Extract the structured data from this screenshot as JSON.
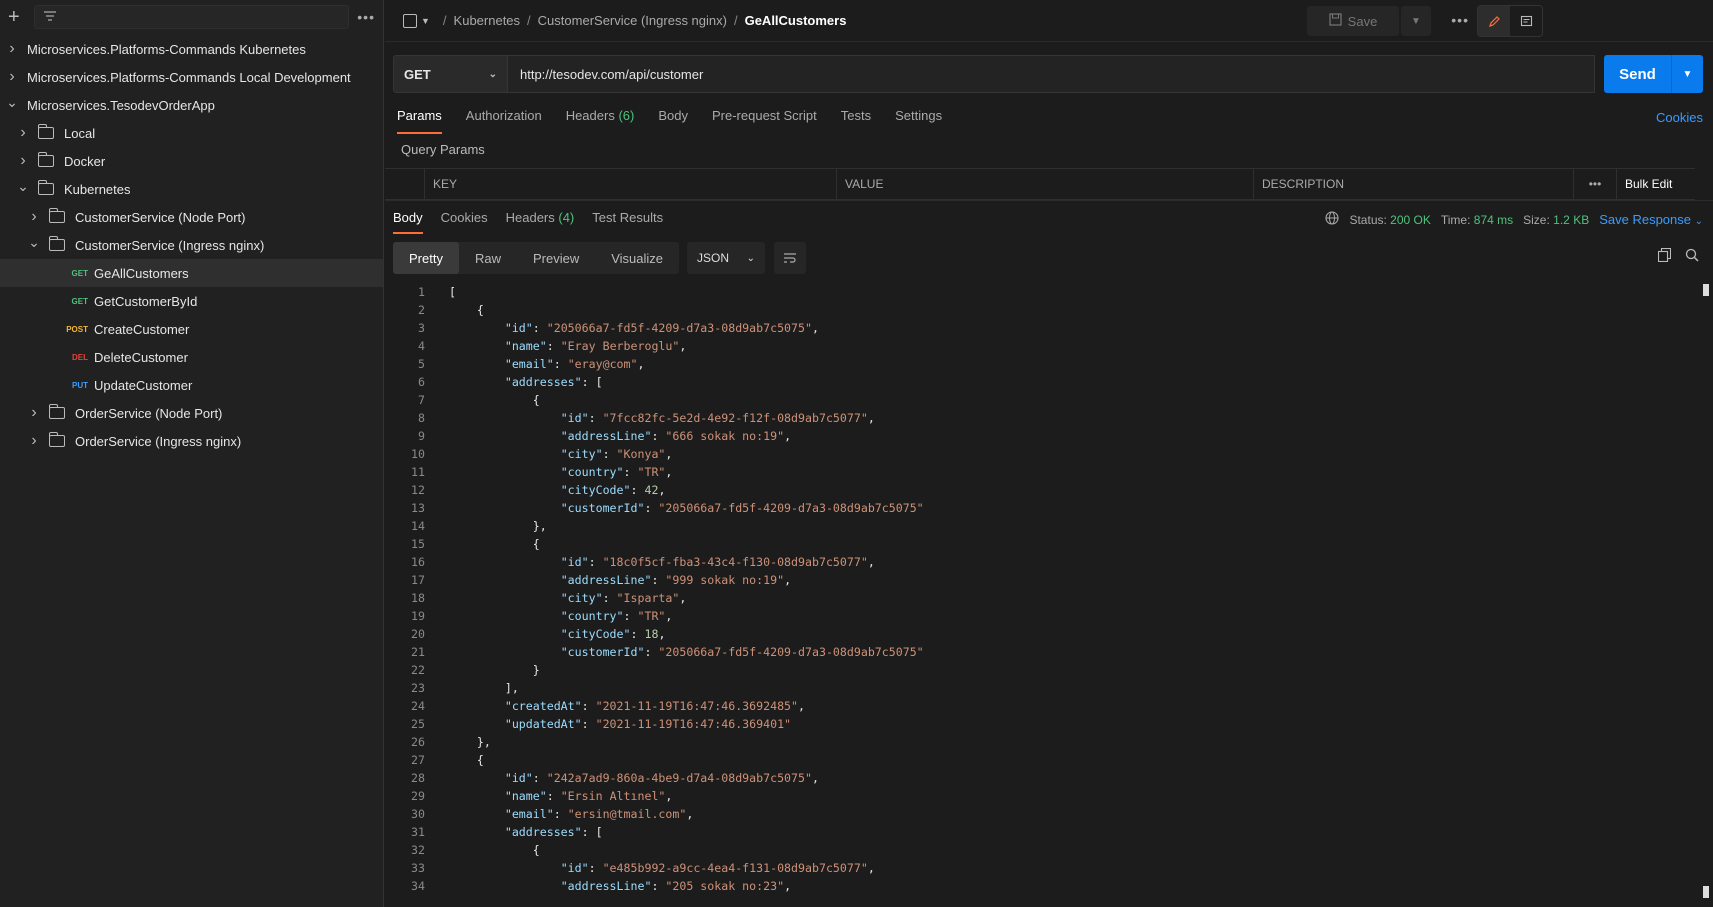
{
  "sidebar": {
    "filter_placeholder": "",
    "items": [
      {
        "label": "Microservices.Platforms-Commands Kubernetes",
        "type": "collection",
        "depth": 0,
        "chev": "right"
      },
      {
        "label": "Microservices.Platforms-Commands Local Development",
        "type": "collection",
        "depth": 0,
        "chev": "right"
      },
      {
        "label": "Microservices.TesodevOrderApp",
        "type": "collection",
        "depth": 0,
        "chev": "down"
      },
      {
        "label": "Local",
        "type": "folder",
        "depth": 1,
        "chev": "right"
      },
      {
        "label": "Docker",
        "type": "folder",
        "depth": 1,
        "chev": "right"
      },
      {
        "label": "Kubernetes",
        "type": "folder",
        "depth": 1,
        "chev": "down"
      },
      {
        "label": "CustomerService (Node Port)",
        "type": "folder",
        "depth": 2,
        "chev": "right"
      },
      {
        "label": "CustomerService (Ingress nginx)",
        "type": "folder",
        "depth": 2,
        "chev": "down"
      },
      {
        "label": "GeAllCustomers",
        "type": "request",
        "method": "GET",
        "depth": 3,
        "selected": true
      },
      {
        "label": "GetCustomerById",
        "type": "request",
        "method": "GET",
        "depth": 3
      },
      {
        "label": "CreateCustomer",
        "type": "request",
        "method": "POST",
        "depth": 3
      },
      {
        "label": "DeleteCustomer",
        "type": "request",
        "method": "DEL",
        "depth": 3
      },
      {
        "label": "UpdateCustomer",
        "type": "request",
        "method": "PUT",
        "depth": 3
      },
      {
        "label": "OrderService (Node Port)",
        "type": "folder",
        "depth": 2,
        "chev": "right"
      },
      {
        "label": "OrderService (Ingress nginx)",
        "type": "folder",
        "depth": 2,
        "chev": "right"
      }
    ]
  },
  "method_colors": {
    "GET": "#4ec27d",
    "POST": "#f5b431",
    "DEL": "#e0453b",
    "PUT": "#3b9cff"
  },
  "breadcrumb": {
    "c1": "Kubernetes",
    "c2": "CustomerService (Ingress nginx)",
    "current": "GeAllCustomers"
  },
  "toolbar": {
    "save": "Save"
  },
  "request": {
    "method": "GET",
    "url": "http://tesodev.com/api/customer",
    "send": "Send"
  },
  "req_tabs": {
    "params": "Params",
    "authorization": "Authorization",
    "headers": "Headers",
    "headers_count": "(6)",
    "body": "Body",
    "prerequest": "Pre-request Script",
    "tests": "Tests",
    "settings": "Settings",
    "cookies": "Cookies"
  },
  "query_params": {
    "title": "Query Params",
    "key": "KEY",
    "value": "VALUE",
    "description": "DESCRIPTION",
    "bulk_edit": "Bulk Edit"
  },
  "res_tabs": {
    "body": "Body",
    "cookies": "Cookies",
    "headers": "Headers",
    "headers_count": "(4)",
    "test_results": "Test Results"
  },
  "response_status": {
    "status_label": "Status:",
    "status": "200 OK",
    "time_label": "Time:",
    "time": "874 ms",
    "size_label": "Size:",
    "size": "1.2 KB",
    "save_response": "Save Response"
  },
  "view": {
    "pretty": "Pretty",
    "raw": "Raw",
    "preview": "Preview",
    "visualize": "Visualize",
    "format": "JSON"
  },
  "code_lines": [
    [
      {
        "t": "p",
        "v": "["
      }
    ],
    [
      {
        "t": "p",
        "v": "    {"
      }
    ],
    [
      {
        "t": "p",
        "v": "        "
      },
      {
        "t": "k",
        "v": "\"id\""
      },
      {
        "t": "p",
        "v": ": "
      },
      {
        "t": "s",
        "v": "\"205066a7-fd5f-4209-d7a3-08d9ab7c5075\""
      },
      {
        "t": "p",
        "v": ","
      }
    ],
    [
      {
        "t": "p",
        "v": "        "
      },
      {
        "t": "k",
        "v": "\"name\""
      },
      {
        "t": "p",
        "v": ": "
      },
      {
        "t": "s",
        "v": "\"Eray Berberoglu\""
      },
      {
        "t": "p",
        "v": ","
      }
    ],
    [
      {
        "t": "p",
        "v": "        "
      },
      {
        "t": "k",
        "v": "\"email\""
      },
      {
        "t": "p",
        "v": ": "
      },
      {
        "t": "s",
        "v": "\"eray@com\""
      },
      {
        "t": "p",
        "v": ","
      }
    ],
    [
      {
        "t": "p",
        "v": "        "
      },
      {
        "t": "k",
        "v": "\"addresses\""
      },
      {
        "t": "p",
        "v": ": ["
      }
    ],
    [
      {
        "t": "p",
        "v": "            {"
      }
    ],
    [
      {
        "t": "p",
        "v": "                "
      },
      {
        "t": "k",
        "v": "\"id\""
      },
      {
        "t": "p",
        "v": ": "
      },
      {
        "t": "s",
        "v": "\"7fcc82fc-5e2d-4e92-f12f-08d9ab7c5077\""
      },
      {
        "t": "p",
        "v": ","
      }
    ],
    [
      {
        "t": "p",
        "v": "                "
      },
      {
        "t": "k",
        "v": "\"addressLine\""
      },
      {
        "t": "p",
        "v": ": "
      },
      {
        "t": "s",
        "v": "\"666 sokak no:19\""
      },
      {
        "t": "p",
        "v": ","
      }
    ],
    [
      {
        "t": "p",
        "v": "                "
      },
      {
        "t": "k",
        "v": "\"city\""
      },
      {
        "t": "p",
        "v": ": "
      },
      {
        "t": "s",
        "v": "\"Konya\""
      },
      {
        "t": "p",
        "v": ","
      }
    ],
    [
      {
        "t": "p",
        "v": "                "
      },
      {
        "t": "k",
        "v": "\"country\""
      },
      {
        "t": "p",
        "v": ": "
      },
      {
        "t": "s",
        "v": "\"TR\""
      },
      {
        "t": "p",
        "v": ","
      }
    ],
    [
      {
        "t": "p",
        "v": "                "
      },
      {
        "t": "k",
        "v": "\"cityCode\""
      },
      {
        "t": "p",
        "v": ": "
      },
      {
        "t": "n",
        "v": "42"
      },
      {
        "t": "p",
        "v": ","
      }
    ],
    [
      {
        "t": "p",
        "v": "                "
      },
      {
        "t": "k",
        "v": "\"customerId\""
      },
      {
        "t": "p",
        "v": ": "
      },
      {
        "t": "s",
        "v": "\"205066a7-fd5f-4209-d7a3-08d9ab7c5075\""
      }
    ],
    [
      {
        "t": "p",
        "v": "            },"
      }
    ],
    [
      {
        "t": "p",
        "v": "            {"
      }
    ],
    [
      {
        "t": "p",
        "v": "                "
      },
      {
        "t": "k",
        "v": "\"id\""
      },
      {
        "t": "p",
        "v": ": "
      },
      {
        "t": "s",
        "v": "\"18c0f5cf-fba3-43c4-f130-08d9ab7c5077\""
      },
      {
        "t": "p",
        "v": ","
      }
    ],
    [
      {
        "t": "p",
        "v": "                "
      },
      {
        "t": "k",
        "v": "\"addressLine\""
      },
      {
        "t": "p",
        "v": ": "
      },
      {
        "t": "s",
        "v": "\"999 sokak no:19\""
      },
      {
        "t": "p",
        "v": ","
      }
    ],
    [
      {
        "t": "p",
        "v": "                "
      },
      {
        "t": "k",
        "v": "\"city\""
      },
      {
        "t": "p",
        "v": ": "
      },
      {
        "t": "s",
        "v": "\"Isparta\""
      },
      {
        "t": "p",
        "v": ","
      }
    ],
    [
      {
        "t": "p",
        "v": "                "
      },
      {
        "t": "k",
        "v": "\"country\""
      },
      {
        "t": "p",
        "v": ": "
      },
      {
        "t": "s",
        "v": "\"TR\""
      },
      {
        "t": "p",
        "v": ","
      }
    ],
    [
      {
        "t": "p",
        "v": "                "
      },
      {
        "t": "k",
        "v": "\"cityCode\""
      },
      {
        "t": "p",
        "v": ": "
      },
      {
        "t": "n",
        "v": "18"
      },
      {
        "t": "p",
        "v": ","
      }
    ],
    [
      {
        "t": "p",
        "v": "                "
      },
      {
        "t": "k",
        "v": "\"customerId\""
      },
      {
        "t": "p",
        "v": ": "
      },
      {
        "t": "s",
        "v": "\"205066a7-fd5f-4209-d7a3-08d9ab7c5075\""
      }
    ],
    [
      {
        "t": "p",
        "v": "            }"
      }
    ],
    [
      {
        "t": "p",
        "v": "        ],"
      }
    ],
    [
      {
        "t": "p",
        "v": "        "
      },
      {
        "t": "k",
        "v": "\"createdAt\""
      },
      {
        "t": "p",
        "v": ": "
      },
      {
        "t": "s",
        "v": "\"2021-11-19T16:47:46.3692485\""
      },
      {
        "t": "p",
        "v": ","
      }
    ],
    [
      {
        "t": "p",
        "v": "        "
      },
      {
        "t": "k",
        "v": "\"updatedAt\""
      },
      {
        "t": "p",
        "v": ": "
      },
      {
        "t": "s",
        "v": "\"2021-11-19T16:47:46.369401\""
      }
    ],
    [
      {
        "t": "p",
        "v": "    },"
      }
    ],
    [
      {
        "t": "p",
        "v": "    {"
      }
    ],
    [
      {
        "t": "p",
        "v": "        "
      },
      {
        "t": "k",
        "v": "\"id\""
      },
      {
        "t": "p",
        "v": ": "
      },
      {
        "t": "s",
        "v": "\"242a7ad9-860a-4be9-d7a4-08d9ab7c5075\""
      },
      {
        "t": "p",
        "v": ","
      }
    ],
    [
      {
        "t": "p",
        "v": "        "
      },
      {
        "t": "k",
        "v": "\"name\""
      },
      {
        "t": "p",
        "v": ": "
      },
      {
        "t": "s",
        "v": "\"Ersin Altınel\""
      },
      {
        "t": "p",
        "v": ","
      }
    ],
    [
      {
        "t": "p",
        "v": "        "
      },
      {
        "t": "k",
        "v": "\"email\""
      },
      {
        "t": "p",
        "v": ": "
      },
      {
        "t": "s",
        "v": "\"ersin@tmail.com\""
      },
      {
        "t": "p",
        "v": ","
      }
    ],
    [
      {
        "t": "p",
        "v": "        "
      },
      {
        "t": "k",
        "v": "\"addresses\""
      },
      {
        "t": "p",
        "v": ": ["
      }
    ],
    [
      {
        "t": "p",
        "v": "            {"
      }
    ],
    [
      {
        "t": "p",
        "v": "                "
      },
      {
        "t": "k",
        "v": "\"id\""
      },
      {
        "t": "p",
        "v": ": "
      },
      {
        "t": "s",
        "v": "\"e485b992-a9cc-4ea4-f131-08d9ab7c5077\""
      },
      {
        "t": "p",
        "v": ","
      }
    ],
    [
      {
        "t": "p",
        "v": "                "
      },
      {
        "t": "k",
        "v": "\"addressLine\""
      },
      {
        "t": "p",
        "v": ": "
      },
      {
        "t": "s",
        "v": "\"205 sokak no:23\""
      },
      {
        "t": "p",
        "v": ","
      }
    ]
  ]
}
